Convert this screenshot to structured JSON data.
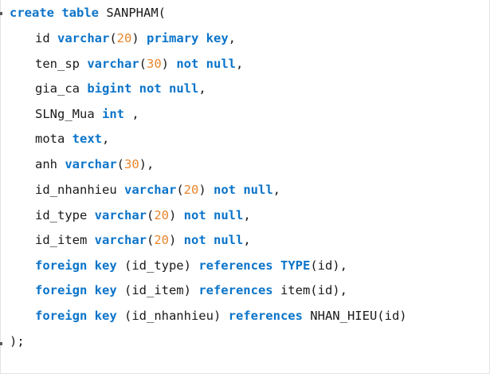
{
  "editor": {
    "lines": [
      {
        "tokens": [
          {
            "t": "kw",
            "v": "create"
          },
          {
            "t": "pl",
            "v": " "
          },
          {
            "t": "kw",
            "v": "table"
          },
          {
            "t": "pl",
            "v": " SANPHAM("
          }
        ]
      },
      {
        "tokens": [
          {
            "t": "pl",
            "v": "id "
          },
          {
            "t": "ty",
            "v": "varchar"
          },
          {
            "t": "pl",
            "v": "("
          },
          {
            "t": "num",
            "v": "20"
          },
          {
            "t": "pl",
            "v": ") "
          },
          {
            "t": "kw",
            "v": "primary key"
          },
          {
            "t": "pl",
            "v": ","
          }
        ]
      },
      {
        "tokens": [
          {
            "t": "pl",
            "v": "ten_sp "
          },
          {
            "t": "ty",
            "v": "varchar"
          },
          {
            "t": "pl",
            "v": "("
          },
          {
            "t": "num",
            "v": "30"
          },
          {
            "t": "pl",
            "v": ") "
          },
          {
            "t": "kw",
            "v": "not null"
          },
          {
            "t": "pl",
            "v": ","
          }
        ]
      },
      {
        "tokens": [
          {
            "t": "pl",
            "v": "gia_ca "
          },
          {
            "t": "ty",
            "v": "bigint"
          },
          {
            "t": "pl",
            "v": " "
          },
          {
            "t": "kw",
            "v": "not null"
          },
          {
            "t": "pl",
            "v": ","
          }
        ]
      },
      {
        "tokens": [
          {
            "t": "pl",
            "v": "SLNg_Mua "
          },
          {
            "t": "ty",
            "v": "int"
          },
          {
            "t": "pl",
            "v": " ,"
          }
        ]
      },
      {
        "tokens": [
          {
            "t": "pl",
            "v": "mota "
          },
          {
            "t": "ty",
            "v": "text"
          },
          {
            "t": "pl",
            "v": ","
          }
        ]
      },
      {
        "tokens": [
          {
            "t": "pl",
            "v": "anh "
          },
          {
            "t": "ty",
            "v": "varchar"
          },
          {
            "t": "pl",
            "v": "("
          },
          {
            "t": "num",
            "v": "30"
          },
          {
            "t": "pl",
            "v": "),"
          }
        ]
      },
      {
        "tokens": [
          {
            "t": "pl",
            "v": "id_nhanhieu "
          },
          {
            "t": "ty",
            "v": "varchar"
          },
          {
            "t": "pl",
            "v": "("
          },
          {
            "t": "num",
            "v": "20"
          },
          {
            "t": "pl",
            "v": ") "
          },
          {
            "t": "kw",
            "v": "not null"
          },
          {
            "t": "pl",
            "v": ","
          }
        ]
      },
      {
        "tokens": [
          {
            "t": "pl",
            "v": "id_type "
          },
          {
            "t": "ty",
            "v": "varchar"
          },
          {
            "t": "pl",
            "v": "("
          },
          {
            "t": "num",
            "v": "20"
          },
          {
            "t": "pl",
            "v": ") "
          },
          {
            "t": "kw",
            "v": "not null"
          },
          {
            "t": "pl",
            "v": ","
          }
        ]
      },
      {
        "tokens": [
          {
            "t": "pl",
            "v": "id_item "
          },
          {
            "t": "ty",
            "v": "varchar"
          },
          {
            "t": "pl",
            "v": "("
          },
          {
            "t": "num",
            "v": "20"
          },
          {
            "t": "pl",
            "v": ") "
          },
          {
            "t": "kw",
            "v": "not null"
          },
          {
            "t": "pl",
            "v": ","
          }
        ]
      },
      {
        "tokens": [
          {
            "t": "kw",
            "v": "foreign key"
          },
          {
            "t": "pl",
            "v": " (id_type) "
          },
          {
            "t": "kw",
            "v": "references"
          },
          {
            "t": "pl",
            "v": " "
          },
          {
            "t": "ty",
            "v": "TYPE"
          },
          {
            "t": "pl",
            "v": "(id),"
          }
        ]
      },
      {
        "tokens": [
          {
            "t": "kw",
            "v": "foreign key"
          },
          {
            "t": "pl",
            "v": " (id_item) "
          },
          {
            "t": "kw",
            "v": "references"
          },
          {
            "t": "pl",
            "v": " item(id),"
          }
        ]
      },
      {
        "tokens": [
          {
            "t": "kw",
            "v": "foreign key"
          },
          {
            "t": "pl",
            "v": " (id_nhanhieu) "
          },
          {
            "t": "kw",
            "v": "references"
          },
          {
            "t": "pl",
            "v": " NHAN_HIEU(id)"
          }
        ]
      },
      {
        "tokens": [
          {
            "t": "pl",
            "v": ");"
          }
        ]
      }
    ],
    "colors": {
      "keyword": "#0b74c9",
      "number": "#e8852b",
      "identifier": "#1a1a1a",
      "background": "#ffffff"
    }
  }
}
